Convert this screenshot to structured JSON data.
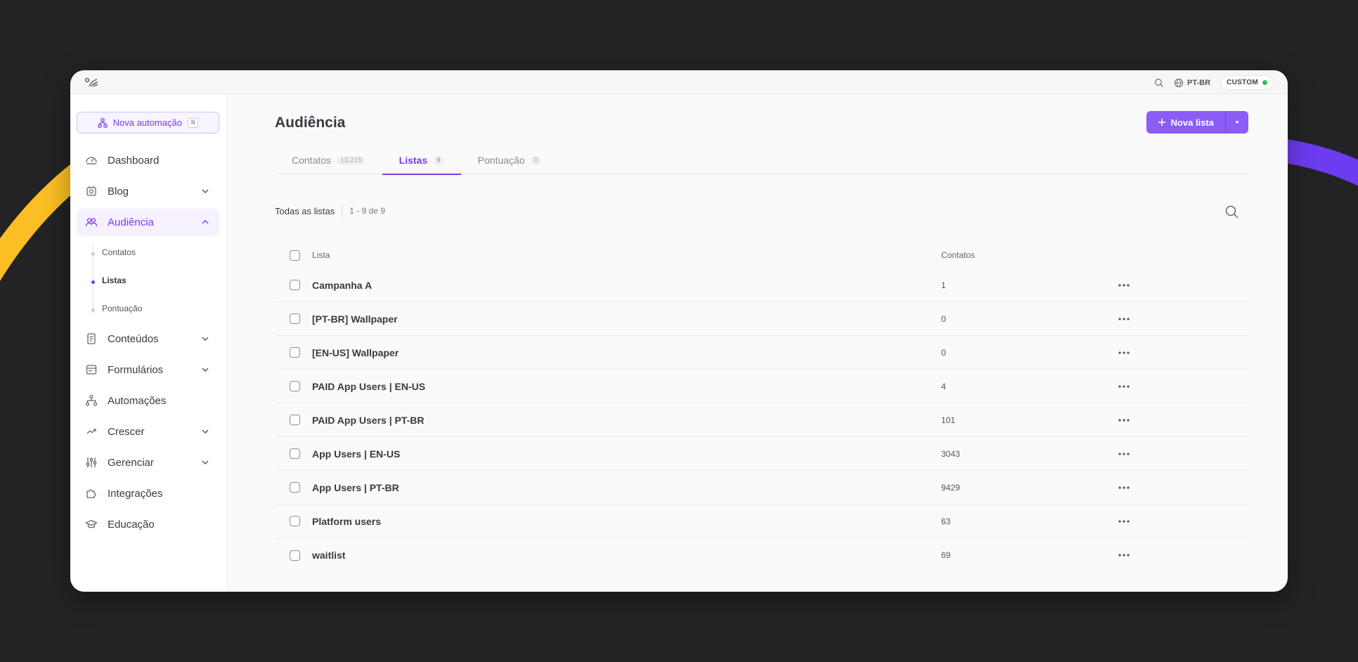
{
  "colors": {
    "accent": "#7c3aed",
    "accent_button": "#8b5cf6",
    "status_online": "#22c55e",
    "deco_yellow": "#fbbf24",
    "deco_purple": "#6d3bf0"
  },
  "topbar": {
    "language": "PT-BR",
    "plan": "CUSTOM",
    "icons": [
      "logo-icon",
      "search-icon",
      "globe-icon"
    ]
  },
  "sidebar": {
    "new_automation": {
      "label": "Nova automação",
      "shortcut": "N",
      "icon": "automation-icon"
    },
    "items": [
      {
        "label": "Dashboard",
        "icon": "dashboard-icon"
      },
      {
        "label": "Blog",
        "icon": "blog-icon",
        "chevron": "down"
      },
      {
        "label": "Audiência",
        "icon": "audience-icon",
        "chevron": "up",
        "active": true
      },
      {
        "label": "Conteúdos",
        "icon": "content-icon",
        "chevron": "down"
      },
      {
        "label": "Formulários",
        "icon": "form-icon",
        "chevron": "down"
      },
      {
        "label": "Automações",
        "icon": "automation-icon"
      },
      {
        "label": "Crescer",
        "icon": "growth-icon",
        "chevron": "down"
      },
      {
        "label": "Gerenciar",
        "icon": "sliders-icon",
        "chevron": "down"
      },
      {
        "label": "Integrações",
        "icon": "puzzle-icon"
      },
      {
        "label": "Educação",
        "icon": "graduation-icon"
      }
    ],
    "audience_sub": [
      {
        "label": "Contatos"
      },
      {
        "label": "Listas",
        "active": true
      },
      {
        "label": "Pontuação"
      }
    ]
  },
  "main": {
    "title": "Audiência",
    "new_list_button": "Nova lista",
    "tabs": [
      {
        "label": "Contatos",
        "count": "13.215"
      },
      {
        "label": "Listas",
        "count": "9",
        "active": true
      },
      {
        "label": "Pontuação",
        "count": "0"
      }
    ],
    "list_title": "Todas as listas",
    "list_range": "1 - 9 de 9",
    "table": {
      "columns": [
        "Lista",
        "Contatos"
      ],
      "rows": [
        {
          "name": "Campanha A",
          "count": "1"
        },
        {
          "name": "[PT-BR] Wallpaper",
          "count": "0"
        },
        {
          "name": "[EN-US] Wallpaper",
          "count": "0"
        },
        {
          "name": "PAID App Users | EN-US",
          "count": "4"
        },
        {
          "name": "PAID App Users | PT-BR",
          "count": "101"
        },
        {
          "name": "App Users | EN-US",
          "count": "3043"
        },
        {
          "name": "App Users | PT-BR",
          "count": "9429"
        },
        {
          "name": "Platform users",
          "count": "63"
        },
        {
          "name": "waitlist",
          "count": "69"
        }
      ]
    }
  }
}
